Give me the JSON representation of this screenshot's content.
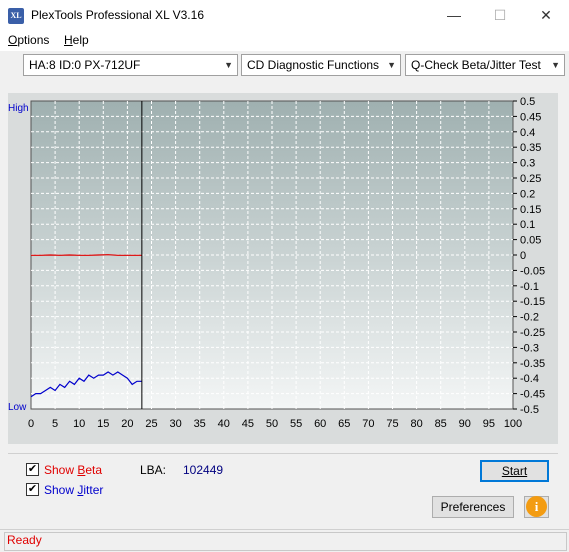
{
  "window": {
    "title": "PlexTools Professional XL V3.16",
    "icon_name": "plextools-xl-icon",
    "icon_text": "XL"
  },
  "window_controls": {
    "minimize": "—",
    "maximize": "☐",
    "close": "✕"
  },
  "menu": {
    "options": "ptions",
    "options_mnemonic": "O",
    "help": "elp",
    "help_mnemonic": "H"
  },
  "toolbar": {
    "drive": "HA:8 ID:0  PX-712UF",
    "function": "CD Diagnostic Functions",
    "test": "Q-Check Beta/Jitter Test"
  },
  "chart_data": {
    "type": "line",
    "left_axis": {
      "top_label": "High",
      "bottom_label": "Low"
    },
    "x_ticks": [
      0,
      5,
      10,
      15,
      20,
      25,
      30,
      35,
      40,
      45,
      50,
      55,
      60,
      65,
      70,
      75,
      80,
      85,
      90,
      95,
      100
    ],
    "xlim": [
      0,
      100
    ],
    "y_ticks": [
      "0.5",
      "0.45",
      "0.4",
      "0.35",
      "0.3",
      "0.25",
      "0.2",
      "0.15",
      "0.1",
      "0.05",
      "0",
      "-0.05",
      "-0.1",
      "-0.15",
      "-0.2",
      "-0.25",
      "-0.3",
      "-0.35",
      "-0.4",
      "-0.45",
      "-0.5"
    ],
    "ylim": [
      -0.5,
      0.5
    ],
    "grid": true,
    "cursor_x": 23,
    "colors": {
      "beta": "#e00000",
      "jitter": "#0000cc",
      "cursor": "#000000",
      "bg_top": "#9fb0b0",
      "bg_bottom": "#f4f6f6"
    },
    "series": [
      {
        "name": "Beta",
        "x": [
          0,
          2,
          4,
          6,
          8,
          10,
          12,
          14,
          16,
          18,
          20,
          22,
          23
        ],
        "y": [
          -0.001,
          -0.001,
          0.0,
          -0.001,
          0.0,
          -0.001,
          -0.001,
          0.0,
          0.001,
          -0.001,
          -0.001,
          -0.001,
          -0.001
        ]
      },
      {
        "name": "Jitter",
        "x": [
          0,
          1,
          2,
          3,
          4,
          5,
          6,
          7,
          8,
          9,
          10,
          11,
          12,
          13,
          14,
          15,
          16,
          17,
          18,
          19,
          20,
          21,
          22,
          23
        ],
        "y": [
          -0.46,
          -0.45,
          -0.45,
          -0.44,
          -0.43,
          -0.44,
          -0.42,
          -0.43,
          -0.41,
          -0.42,
          -0.4,
          -0.41,
          -0.39,
          -0.4,
          -0.39,
          -0.39,
          -0.38,
          -0.39,
          -0.38,
          -0.39,
          -0.4,
          -0.42,
          -0.41,
          -0.41
        ]
      }
    ]
  },
  "controls": {
    "show_beta_prefix": "Show ",
    "show_beta_mnemonic": "B",
    "show_beta_suffix": "eta",
    "show_beta_checked": true,
    "show_jitter_prefix": "Show ",
    "show_jitter_mnemonic": "J",
    "show_jitter_suffix": "itter",
    "show_jitter_checked": true,
    "lba_label": "LBA:",
    "lba_value": "102449",
    "start_label": "Start",
    "preferences_label": "Preferences",
    "info_label": "i"
  },
  "status": {
    "text": "Ready"
  }
}
